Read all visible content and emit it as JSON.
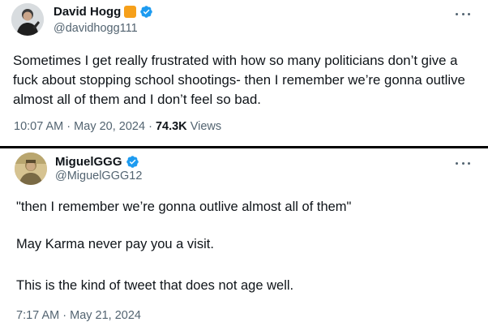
{
  "tweets": [
    {
      "display_name": "David Hogg",
      "handle": "@davidhogg111",
      "verified": true,
      "has_orange_badge": true,
      "text": "Sometimes I get really frustrated with how so many politicians don’t give a fuck about stopping school shootings- then I remember we’re gonna outlive almost all of them and I don’t feel so bad.",
      "time": "10:07 AM",
      "date": "May 20, 2024",
      "views_count": "74.3K",
      "views_label": "Views"
    },
    {
      "display_name": "MiguelGGG",
      "handle": "@MiguelGGG12",
      "verified": true,
      "lines": [
        "\"then I remember we’re gonna outlive almost all of them\"",
        "May Karma never pay you a visit.",
        "This is the kind of tweet that does not age well."
      ],
      "time": "7:17 AM",
      "date": "May 21, 2024"
    }
  ],
  "separator_dot": "·",
  "colors": {
    "text": "#0f1419",
    "secondary": "#536471",
    "verified_blue": "#1d9bf0",
    "orange_badge": "#f6a01a"
  },
  "icons": [
    "verified-icon",
    "more-icon"
  ]
}
